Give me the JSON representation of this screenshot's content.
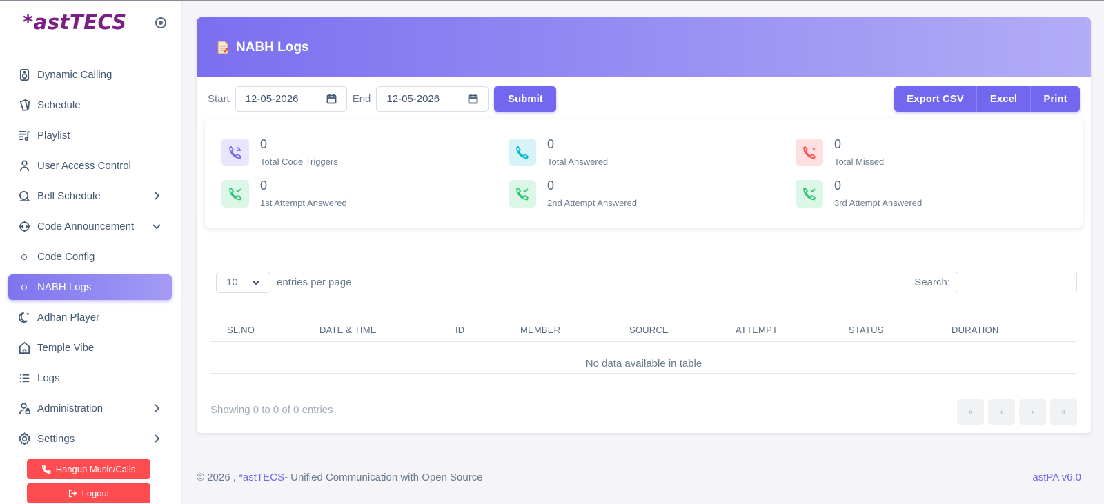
{
  "brand": {
    "name": "*astTECS"
  },
  "sidebar": {
    "items": [
      {
        "label": "Dynamic Calling",
        "icon": "speaker-icon"
      },
      {
        "label": "Schedule",
        "icon": "calendar-icon"
      },
      {
        "label": "Playlist",
        "icon": "playlist-icon"
      },
      {
        "label": "User Access Control",
        "icon": "user-icon"
      },
      {
        "label": "Bell Schedule",
        "icon": "bell-icon"
      },
      {
        "label": "Code Announcement",
        "icon": "settings-code-icon"
      },
      {
        "label": "Code Config",
        "icon": "circle-icon"
      },
      {
        "label": "NABH Logs",
        "icon": "circle-icon"
      },
      {
        "label": "Adhan Player",
        "icon": "moon-icon"
      },
      {
        "label": "Temple Vibe",
        "icon": "temple-icon"
      },
      {
        "label": "Logs",
        "icon": "list-icon"
      },
      {
        "label": "Administration",
        "icon": "user-lock-icon"
      },
      {
        "label": "Settings",
        "icon": "gear-icon"
      }
    ],
    "hangup_label": "Hangup Music/Calls",
    "logout_label": "Logout"
  },
  "page": {
    "title": "NABH Logs"
  },
  "filter": {
    "start_label": "Start",
    "start_value": "12-05-2026",
    "end_label": "End",
    "end_value": "12-05-2026",
    "submit_label": "Submit"
  },
  "export": {
    "csv_label": "Export CSV",
    "excel_label": "Excel",
    "print_label": "Print"
  },
  "stats": [
    {
      "value": "0",
      "label": "Total Code Triggers",
      "color": "#7367f0",
      "bg": "#e8e6fd"
    },
    {
      "value": "0",
      "label": "Total Answered",
      "color": "#00bad1",
      "bg": "#d6f4f8"
    },
    {
      "value": "0",
      "label": "Total Missed",
      "color": "#ff4c51",
      "bg": "#ffe0e1"
    },
    {
      "value": "0",
      "label": "1st Attempt Answered",
      "color": "#28c76f",
      "bg": "#dcf6e8"
    },
    {
      "value": "0",
      "label": "2nd Attempt Answered",
      "color": "#28c76f",
      "bg": "#dcf6e8"
    },
    {
      "value": "0",
      "label": "3rd Attempt Answered",
      "color": "#28c76f",
      "bg": "#dcf6e8"
    }
  ],
  "table": {
    "length_value": "10",
    "length_label": "entries per page",
    "search_label": "Search:",
    "columns": [
      "SL.NO",
      "DATE & TIME",
      "ID",
      "MEMBER",
      "SOURCE",
      "ATTEMPT",
      "STATUS",
      "DURATION"
    ],
    "empty_text": "No data available in table",
    "info_text": "Showing 0 to 0 of 0 entries",
    "pager": [
      "«",
      "‹",
      "›",
      "»"
    ]
  },
  "footer": {
    "prefix": "© 2026 , ",
    "brand": "*astTECS",
    "suffix": "- Unified Communication with Open Source",
    "version": "astPA v6.0"
  }
}
